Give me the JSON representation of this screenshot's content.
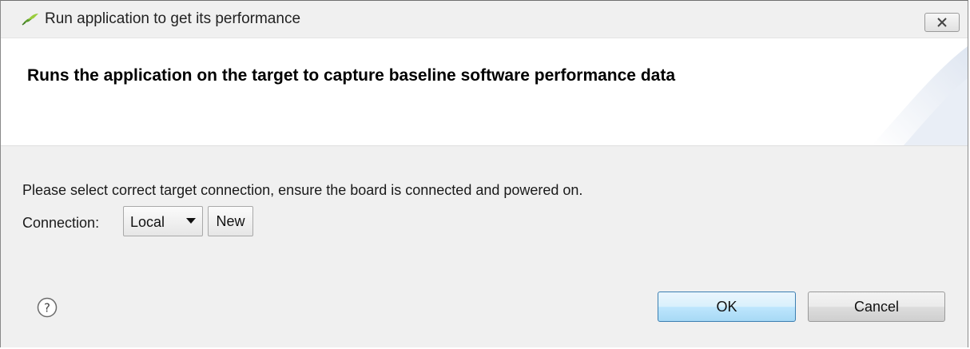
{
  "window": {
    "title": "Run application to get its performance",
    "close_symbol": "✕"
  },
  "header": {
    "title": "Runs the application on the target to capture baseline software performance data"
  },
  "body": {
    "instruction": "Please select correct target connection, ensure the board is connected and powered on.",
    "connection_label": "Connection:",
    "connection_value": "Local",
    "new_button": "New"
  },
  "footer": {
    "ok_button": "OK",
    "cancel_button": "Cancel"
  },
  "icons": {
    "app": "app-logo-icon",
    "close": "close-icon",
    "dropdown": "chevron-down-icon",
    "help": "help-icon"
  },
  "colors": {
    "ok_border": "#3c7fb1",
    "ok_fill": "#bee6fd",
    "logo_green": "#7db542"
  }
}
